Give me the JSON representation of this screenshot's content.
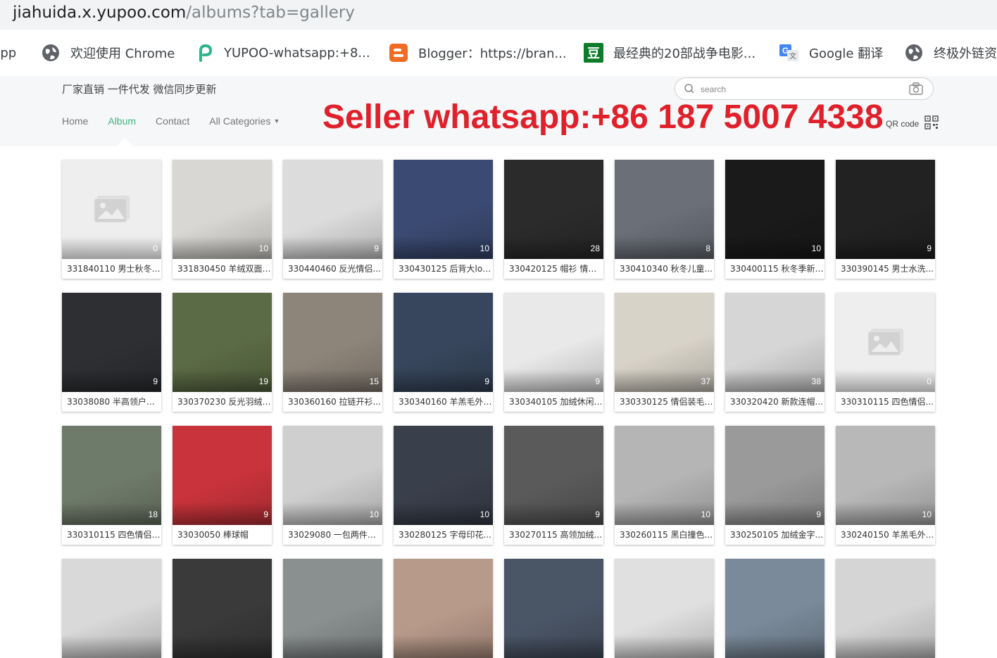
{
  "browser": {
    "url_host": "jiahuida.x.yupoo.com",
    "url_path": "/albums?tab=gallery"
  },
  "bookmarks": [
    {
      "label": "App",
      "icon": "app-icon"
    },
    {
      "label": "欢迎使用 Chrome",
      "icon": "globe-icon"
    },
    {
      "label": "YUPOO-whatsapp:+8...",
      "icon": "yupoo-icon"
    },
    {
      "label": "Blogger：https://bran...",
      "icon": "blogger-icon"
    },
    {
      "label": "最经典的20部战争电影...",
      "icon": "douban-icon"
    },
    {
      "label": "Google 翻译",
      "icon": "google-translate-icon"
    },
    {
      "label": "终极外链资",
      "icon": "globe-icon"
    }
  ],
  "site": {
    "slogan": "厂家直销 一件代发 微信同步更新",
    "search_placeholder": "search",
    "nav": [
      "Home",
      "Album",
      "Contact",
      "All Categories"
    ],
    "active_nav": "Album",
    "qr_label": "QR code",
    "overlay": "Seller whatsapp:+86 187 5007 4338"
  },
  "albums": [
    {
      "title": "331840110 男士秋冬季...",
      "count": "0",
      "placeholder": true
    },
    {
      "title": "331830450 羊绒双面呢...",
      "count": "10",
      "color": "#d9d7d3"
    },
    {
      "title": "330440460 反光情侣...",
      "count": "9",
      "color": "#dcdcdc"
    },
    {
      "title": "330430125 后背大logo...",
      "count": "10",
      "color": "#3b4a72"
    },
    {
      "title": "330420125 帽衫 情侣...",
      "count": "28",
      "color": "#2b2b2b"
    },
    {
      "title": "330410340 秋冬儿童...",
      "count": "8",
      "color": "#6a6f78"
    },
    {
      "title": "330400115 秋冬季新款...",
      "count": "10",
      "color": "#1a1a1a"
    },
    {
      "title": "330390145 男士水洗...",
      "count": "9",
      "color": "#222222"
    },
    {
      "title": "33038080 半高领户外...",
      "count": "9",
      "color": "#2e2f33"
    },
    {
      "title": "330370230 反光羽绒服...",
      "count": "19",
      "color": "#5b6b45"
    },
    {
      "title": "330360160 拉链开衫...",
      "count": "15",
      "color": "#8e857a"
    },
    {
      "title": "330340160 羊羔毛外套...",
      "count": "9",
      "color": "#37465c"
    },
    {
      "title": "330340105 加绒休闲裤...",
      "count": "9",
      "color": "#e9e9ea"
    },
    {
      "title": "330330125 情侣装毛衣...",
      "count": "37",
      "color": "#d8d3c8"
    },
    {
      "title": "330320420 新款连帽...",
      "count": "38",
      "color": "#d6d6d6"
    },
    {
      "title": "330310115 四色情侣...",
      "count": "0",
      "placeholder": true
    },
    {
      "title": "330310115 四色情侣卫衣...",
      "count": "18",
      "color": "#6f7b6a"
    },
    {
      "title": "33030050 棒球帽",
      "count": "9",
      "color": "#c9333b"
    },
    {
      "title": "33029080 一包两件套...",
      "count": "10",
      "color": "#cfcfcf"
    },
    {
      "title": "330280125 字母印花...",
      "count": "10",
      "color": "#3a3f4c"
    },
    {
      "title": "330270115 高领加绒...",
      "count": "9",
      "color": "#5a5a5a"
    },
    {
      "title": "330260115 黑白撞色...",
      "count": "10",
      "color": "#b5b5b5"
    },
    {
      "title": "330250105 加绒金字...",
      "count": "9",
      "color": "#9a9a9a"
    },
    {
      "title": "330240150 羊羔毛外套...",
      "count": "10",
      "color": "#b8b8b8"
    },
    {
      "title": "",
      "count": "",
      "color": "#d9d9d9"
    },
    {
      "title": "",
      "count": "",
      "color": "#3a3a3a"
    },
    {
      "title": "",
      "count": "",
      "color": "#8a8f8f"
    },
    {
      "title": "",
      "count": "",
      "color": "#b89a8a"
    },
    {
      "title": "",
      "count": "",
      "color": "#4a5566"
    },
    {
      "title": "",
      "count": "",
      "color": "#e0e0e0"
    },
    {
      "title": "",
      "count": "",
      "color": "#7a8a9a"
    },
    {
      "title": "",
      "count": "",
      "color": "#d5d5d5"
    }
  ]
}
